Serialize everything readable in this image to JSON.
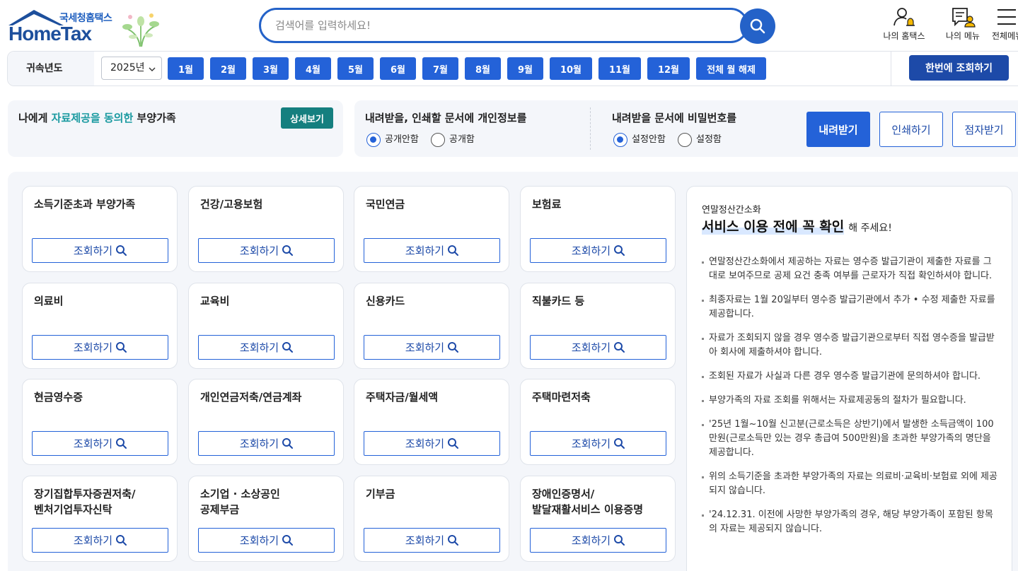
{
  "header": {
    "logo_sub": "국세청홈택스",
    "logo_main": "HomeTax",
    "search_placeholder": "검색어를 입력하세요!",
    "menus": [
      "나의 홈택스",
      "나의 메뉴",
      "전체메뉴"
    ]
  },
  "filter": {
    "label": "귀속년도",
    "year": "2025년",
    "months": [
      "1월",
      "2월",
      "3월",
      "4월",
      "5월",
      "6월",
      "7월",
      "8월",
      "9월",
      "10월",
      "11월",
      "12월"
    ],
    "clear_all": "전체 월 해제",
    "query_all": "한번에 조회하기"
  },
  "dependents": {
    "title_pre": "나에게 ",
    "title_hl": "자료제공을 동의한",
    "title_post": " 부양가족",
    "detail_btn": "상세보기"
  },
  "doc_options": {
    "privacy_title": "내려받을, 인쇄할 문서에 개인정보를",
    "privacy_opts": [
      "공개안함",
      "공개함"
    ],
    "privacy_selected": 0,
    "password_title": "내려받을 문서에 비밀번호를",
    "password_opts": [
      "설정안함",
      "설정함"
    ],
    "password_selected": 0,
    "download": "내려받기",
    "print": "인쇄하기",
    "braille": "점자받기"
  },
  "cards": {
    "query_label": "조회하기",
    "items": [
      "소득기준초과 부양가족",
      "건강/고용보험",
      "국민연금",
      "보험료",
      "의료비",
      "교육비",
      "신용카드",
      "직불카드 등",
      "현금영수증",
      "개인연금저축/연금계좌",
      "주택자금/월세액",
      "주택마련저축",
      "장기집합투자증권저축/\n벤처기업투자신탁",
      "소기업 · 소상공인\n공제부금",
      "기부금",
      "장애인증명서/\n발달재활서비스 이용증명"
    ]
  },
  "notice": {
    "subtitle": "연말정산간소화",
    "heading": "서비스 이용 전에 꼭 확인",
    "heading_tail": "해 주세요!",
    "items": [
      "연말정산간소화에서 제공하는 자료는 영수증 발급기관이 제출한 자료를 그대로 보여주므로 공제 요건 충족 여부를 근로자가 직접 확인하셔야 합니다.",
      "최종자료는 1월 20일부터 영수증 발급기관에서 추가 • 수정 제출한 자료를 제공합니다.",
      "자료가 조회되지 않을 경우 영수증 발급기관으로부터 직접 영수증을 발급받아 회사에 제출하셔야 합니다.",
      "조회된 자료가 사실과 다른 경우 영수증 발급기관에 문의하셔야 합니다.",
      "부양가족의 자료 조회를 위해서는 자료제공동의 절차가 필요합니다.",
      "'25년 1월~10월 신고분(근로소득은 상반기)에서 발생한 소득금액이 100만원(근로소득만 있는 경우 총급여 500만원)을 초과한 부양가족의 명단을 제공합니다.",
      "위의 소득기준을 초과한 부양가족의 자료는 의료비·교육비·보험료 외에 제공되지 않습니다.",
      "'24.12.31. 이전에 사망한 부양가족의 경우, 해당 부양가족이 포함된 항목의 자료는 제공되지 않습니다."
    ]
  },
  "colors": {
    "primary": "#2462d8",
    "dark_primary": "#1d4aa8",
    "teal": "#157f7f",
    "panel_bg": "#f4f6fa"
  }
}
